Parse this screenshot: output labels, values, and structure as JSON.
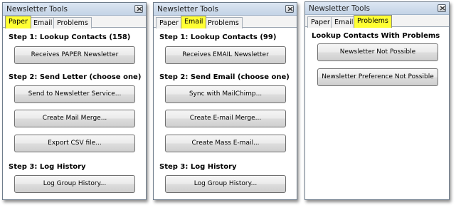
{
  "window_title": "Newsletter Tools",
  "tabs": [
    "Paper",
    "Email",
    "Problems"
  ],
  "paper": {
    "step1": "Step 1:  Lookup Contacts (158)",
    "receives_btn": "Receives PAPER Newsletter",
    "step2": "Step 2:  Send Letter (choose one)",
    "send_service_btn": "Send to Newsletter Service...",
    "mail_merge_btn": "Create Mail Merge...",
    "export_csv_btn": "Export CSV file...",
    "step3": "Step 3:  Log History",
    "log_history_btn": "Log Group History..."
  },
  "email": {
    "step1": "Step 1:  Lookup Contacts (99)",
    "receives_btn": "Receives EMAIL Newsletter",
    "step2": "Step 2:  Send Email (choose one)",
    "mailchimp_btn": "Sync with MailChimp...",
    "email_merge_btn": "Create E-mail Merge...",
    "mass_email_btn": "Create Mass E-mail...",
    "step3": "Step 3:  Log History",
    "log_history_btn": "Log Group History..."
  },
  "problems": {
    "heading": "Lookup Contacts With Problems",
    "not_possible_btn": "Newsletter Not Possible",
    "pref_not_possible_btn": "Newsletter Preference Not Possible"
  },
  "colors": {
    "active_tab": "#ffff33",
    "title_bar": "#c3d3e6"
  }
}
